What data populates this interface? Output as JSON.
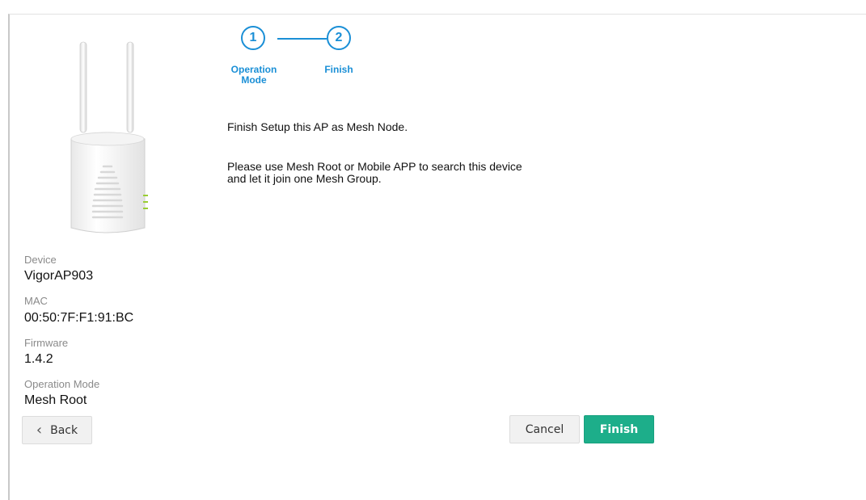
{
  "wizard": {
    "steps": [
      {
        "number": "1",
        "label": "Operation Mode"
      },
      {
        "number": "2",
        "label": "Finish"
      }
    ]
  },
  "device": {
    "labels": {
      "device": "Device",
      "mac": "MAC",
      "firmware": "Firmware",
      "operation_mode": "Operation Mode"
    },
    "values": {
      "device": "VigorAP903",
      "mac": "00:50:7F:F1:91:BC",
      "firmware": "1.4.2",
      "operation_mode": "Mesh Root"
    }
  },
  "content": {
    "line1": "Finish Setup this AP as Mesh Node.",
    "line2": "Please use Mesh Root or Mobile APP to search this device and let it join one Mesh Group."
  },
  "buttons": {
    "back": "Back",
    "cancel": "Cancel",
    "finish": "Finish"
  },
  "colors": {
    "accent": "#1a8fd6",
    "finish_button": "#1dae8a"
  }
}
